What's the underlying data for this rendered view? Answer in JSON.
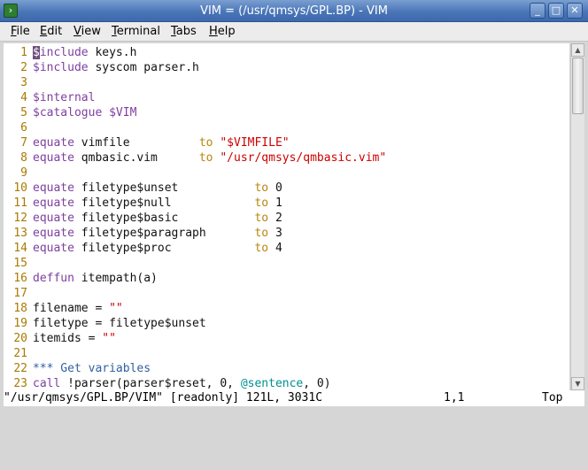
{
  "window": {
    "title": "VIM = (/usr/qmsys/GPL.BP) - VIM"
  },
  "menu": [
    "File",
    "Edit",
    "View",
    "Terminal",
    "Tabs",
    "Help"
  ],
  "lines": [
    {
      "n": "1",
      "segs": [
        [
          "k",
          "$include"
        ],
        [
          "t",
          " keys.h"
        ]
      ]
    },
    {
      "n": "2",
      "segs": [
        [
          "k",
          "$include"
        ],
        [
          "t",
          " syscom parser.h"
        ]
      ]
    },
    {
      "n": "3",
      "segs": []
    },
    {
      "n": "4",
      "segs": [
        [
          "k",
          "$internal"
        ]
      ]
    },
    {
      "n": "5",
      "segs": [
        [
          "k",
          "$catalogue $VIM"
        ]
      ]
    },
    {
      "n": "6",
      "segs": []
    },
    {
      "n": "7",
      "segs": [
        [
          "k",
          "equate"
        ],
        [
          "t",
          " vimfile          "
        ],
        [
          "o",
          "to"
        ],
        [
          "t",
          " "
        ],
        [
          "s",
          "\"$VIMFILE\""
        ]
      ]
    },
    {
      "n": "8",
      "segs": [
        [
          "k",
          "equate"
        ],
        [
          "t",
          " qmbasic.vim      "
        ],
        [
          "o",
          "to"
        ],
        [
          "t",
          " "
        ],
        [
          "s",
          "\"/usr/qmsys/qmbasic.vim\""
        ]
      ]
    },
    {
      "n": "9",
      "segs": []
    },
    {
      "n": "10",
      "segs": [
        [
          "k",
          "equate"
        ],
        [
          "t",
          " filetype$unset           "
        ],
        [
          "o",
          "to"
        ],
        [
          "t",
          " "
        ],
        [
          "n",
          "0"
        ]
      ]
    },
    {
      "n": "11",
      "segs": [
        [
          "k",
          "equate"
        ],
        [
          "t",
          " filetype$null            "
        ],
        [
          "o",
          "to"
        ],
        [
          "t",
          " "
        ],
        [
          "n",
          "1"
        ]
      ]
    },
    {
      "n": "12",
      "segs": [
        [
          "k",
          "equate"
        ],
        [
          "t",
          " filetype$basic           "
        ],
        [
          "o",
          "to"
        ],
        [
          "t",
          " "
        ],
        [
          "n",
          "2"
        ]
      ]
    },
    {
      "n": "13",
      "segs": [
        [
          "k",
          "equate"
        ],
        [
          "t",
          " filetype$paragraph       "
        ],
        [
          "o",
          "to"
        ],
        [
          "t",
          " "
        ],
        [
          "n",
          "3"
        ]
      ]
    },
    {
      "n": "14",
      "segs": [
        [
          "k",
          "equate"
        ],
        [
          "t",
          " filetype$proc            "
        ],
        [
          "o",
          "to"
        ],
        [
          "t",
          " "
        ],
        [
          "n",
          "4"
        ]
      ]
    },
    {
      "n": "15",
      "segs": []
    },
    {
      "n": "16",
      "segs": [
        [
          "k",
          "deffun"
        ],
        [
          "t",
          " itempath(a)"
        ]
      ]
    },
    {
      "n": "17",
      "segs": []
    },
    {
      "n": "18",
      "segs": [
        [
          "t",
          "filename = "
        ],
        [
          "s",
          "\"\""
        ]
      ]
    },
    {
      "n": "19",
      "segs": [
        [
          "t",
          "filetype = filetype$unset"
        ]
      ]
    },
    {
      "n": "20",
      "segs": [
        [
          "t",
          "itemids = "
        ],
        [
          "s",
          "\"\""
        ]
      ]
    },
    {
      "n": "21",
      "segs": []
    },
    {
      "n": "22",
      "segs": [
        [
          "c",
          "*** Get variables"
        ]
      ]
    },
    {
      "n": "23",
      "segs": [
        [
          "k",
          "call"
        ],
        [
          "t",
          " !parser(parser$reset, 0, "
        ],
        [
          "v",
          "@sentence"
        ],
        [
          "t",
          ", 0)"
        ]
      ]
    }
  ],
  "status": {
    "message": "\"/usr/qmsys/GPL.BP/VIM\" [readonly] 121L, 3031C",
    "position": "1,1",
    "percent": "Top"
  },
  "colors": {
    "keyword": "#7e3fa0",
    "string": "#cc0000",
    "operator": "#b8860b",
    "comment": "#3060a0",
    "variable": "#009090",
    "line_number": "#a87a00"
  }
}
